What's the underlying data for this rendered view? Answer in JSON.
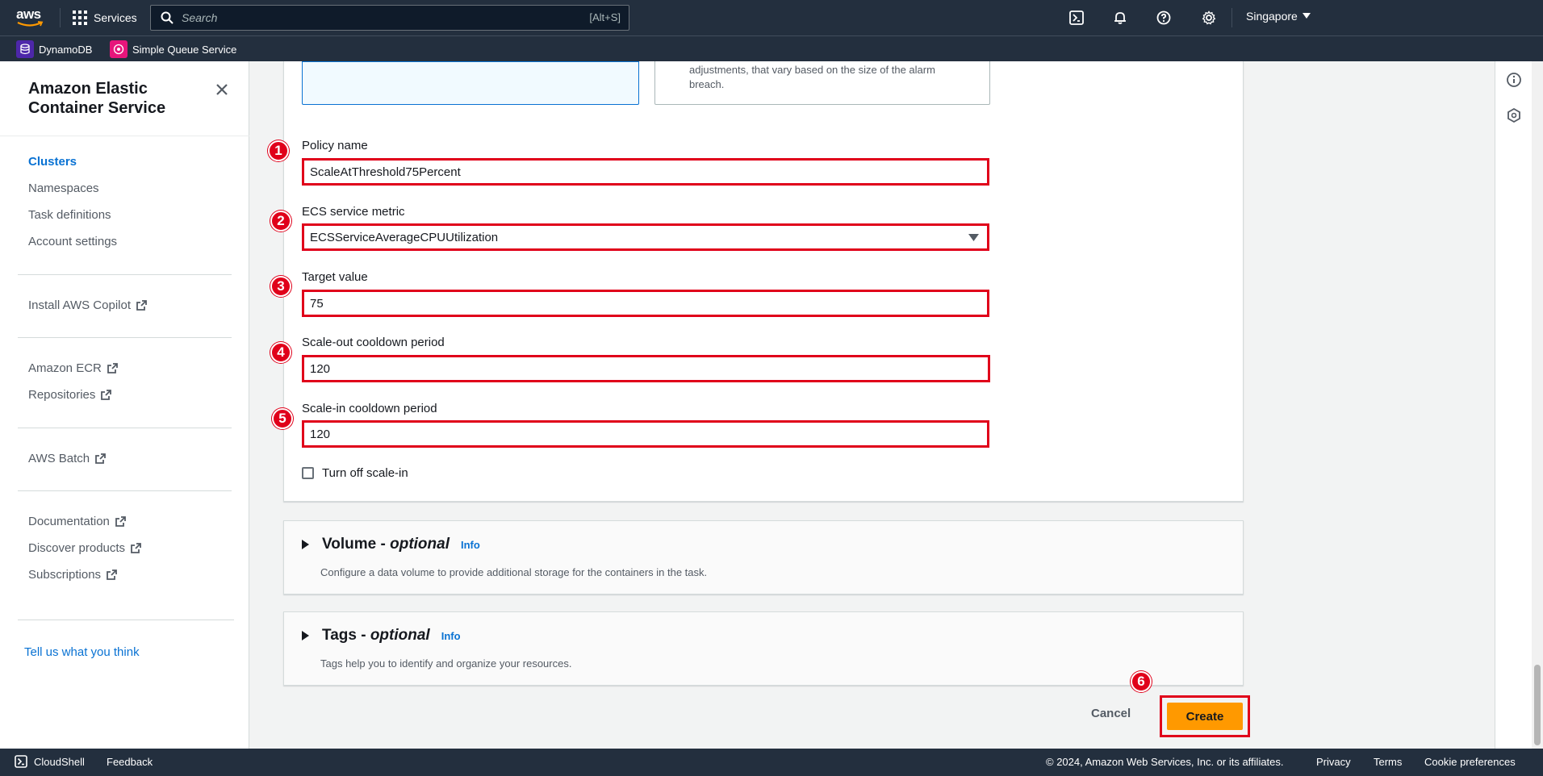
{
  "topnav": {
    "logo_text": "aws",
    "services_label": "Services",
    "search_placeholder": "Search",
    "search_shortcut": "[Alt+S]",
    "region": "Singapore"
  },
  "favorites": [
    {
      "label": "DynamoDB",
      "color": "#4d27aa"
    },
    {
      "label": "Simple Queue Service",
      "color": "#e7157b"
    }
  ],
  "sidebar": {
    "title": "Amazon Elastic Container Service",
    "nav": [
      {
        "label": "Clusters",
        "active": true
      },
      {
        "label": "Namespaces"
      },
      {
        "label": "Task definitions"
      },
      {
        "label": "Account settings"
      }
    ],
    "install_copilot": "Install AWS Copilot",
    "amazon_ecr": "Amazon ECR",
    "repositories": "Repositories",
    "aws_batch": "AWS Batch",
    "documentation": "Documentation",
    "discover_products": "Discover products",
    "subscriptions": "Subscriptions",
    "feedback": "Tell us what you think"
  },
  "form": {
    "tile_right_text_1": "adjustments, that vary based on the size of the alarm",
    "tile_right_text_2": "breach.",
    "policy_name_label": "Policy name",
    "policy_name_value": "ScaleAtThreshold75Percent",
    "metric_label": "ECS service metric",
    "metric_value": "ECSServiceAverageCPUUtilization",
    "target_label": "Target value",
    "target_value": "75",
    "scale_out_label": "Scale-out cooldown period",
    "scale_out_value": "120",
    "scale_in_label": "Scale-in cooldown period",
    "scale_in_value": "120",
    "turn_off_label": "Turn off scale-in",
    "badges": [
      "1",
      "2",
      "3",
      "4",
      "5",
      "6"
    ]
  },
  "volume": {
    "title": "Volume - ",
    "optional": "optional",
    "info": "Info",
    "desc": "Configure a data volume to provide additional storage for the containers in the task."
  },
  "tags": {
    "title": "Tags - ",
    "optional": "optional",
    "info": "Info",
    "desc": "Tags help you to identify and organize your resources."
  },
  "actions": {
    "cancel": "Cancel",
    "create": "Create"
  },
  "footer": {
    "cloudshell": "CloudShell",
    "feedback": "Feedback",
    "copyright": "© 2024, Amazon Web Services, Inc. or its affiliates.",
    "privacy": "Privacy",
    "terms": "Terms",
    "cookie": "Cookie preferences"
  }
}
